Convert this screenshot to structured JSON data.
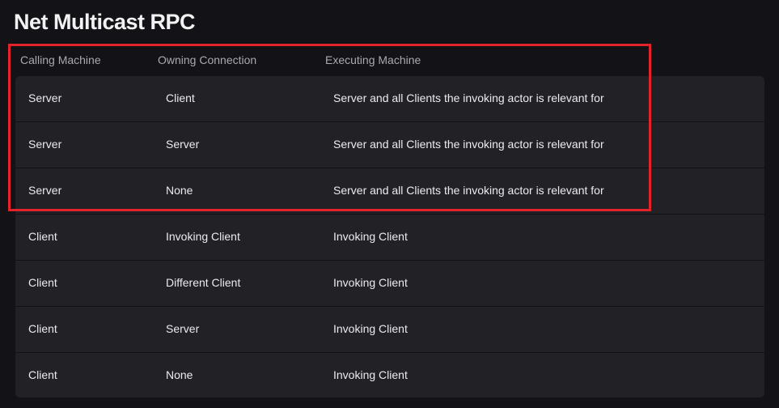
{
  "title": "Net Multicast RPC",
  "table": {
    "headers": [
      "Calling Machine",
      "Owning Connection",
      "Executing Machine"
    ],
    "rows": [
      [
        "Server",
        "Client",
        "Server and all Clients the invoking actor is relevant for"
      ],
      [
        "Server",
        "Server",
        "Server and all Clients the invoking actor is relevant for"
      ],
      [
        "Server",
        "None",
        "Server and all Clients the invoking actor is relevant for"
      ],
      [
        "Client",
        "Invoking Client",
        "Invoking Client"
      ],
      [
        "Client",
        "Different Client",
        "Invoking Client"
      ],
      [
        "Client",
        "Server",
        "Invoking Client"
      ],
      [
        "Client",
        "None",
        "Invoking Client"
      ]
    ]
  },
  "highlight": {
    "color": "#e3232b",
    "covers_rows": 3
  }
}
